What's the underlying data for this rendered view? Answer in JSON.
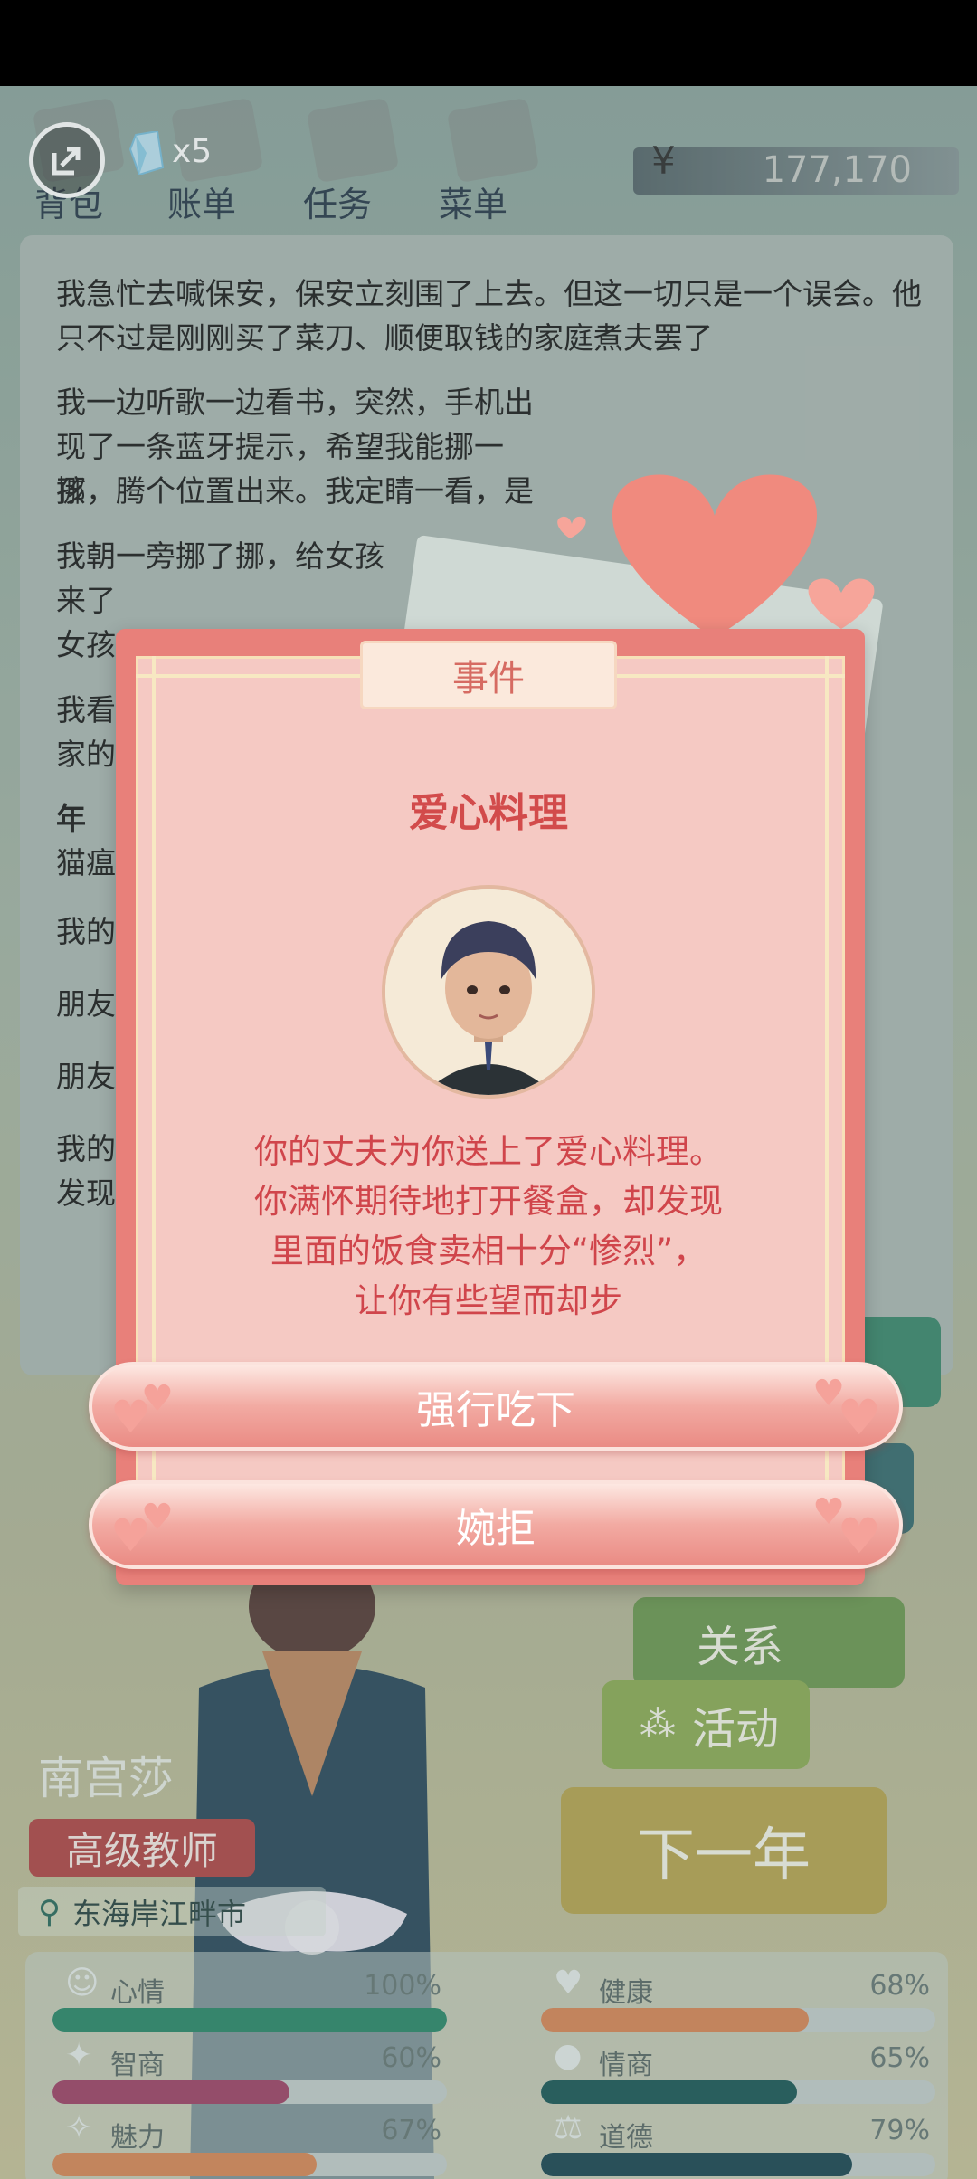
{
  "top_nav": {
    "items": [
      {
        "label": "背包"
      },
      {
        "label": "账单"
      },
      {
        "label": "任务"
      },
      {
        "label": "菜单"
      }
    ],
    "gem_count": "x5",
    "currency_symbol": "¥",
    "money": "177,170"
  },
  "story": {
    "paragraphs": [
      "我急忙去喊保安，保安立刻围了上去。但这一切只是一个误会。他只不过是刚刚买了菜刀、顺便取钱的家庭煮夫罢了",
      "我一边听歌一边看书，突然，手机出现了一条蓝牙提示，希望我能挪一挪，腾个位置出来。我定睛一看，是",
      "孩",
      "我朝一旁挪了挪，给女孩",
      "来了",
      "女孩",
      "我看",
      "家的",
      "年",
      "猫瘟",
      "我的",
      "朋友",
      "朋友",
      "我的",
      "发现"
    ]
  },
  "event_dialog": {
    "tag": "事件",
    "title": "爱心料理",
    "description_lines": [
      "你的丈夫为你送上了爱心料理。",
      "你满怀期待地打开餐盒，却发现",
      "里面的饭食卖相十分“惨烈”，",
      "让你有些望而却步"
    ],
    "buttons": [
      {
        "label": "强行吃下"
      },
      {
        "label": "婉拒"
      }
    ]
  },
  "side_menu": {
    "relation_label": "关系",
    "activity_label": "活动",
    "next_year_label": "下一年"
  },
  "character": {
    "name": "南宫莎",
    "job": "高级教师",
    "location": "东海岸江畔市"
  },
  "stats": [
    {
      "label": "心情",
      "value": "100%",
      "fraction": 1.0,
      "color": "#2f8a6c",
      "icon": "smile-icon"
    },
    {
      "label": "健康",
      "value": "68%",
      "fraction": 0.68,
      "color": "#d9895a",
      "icon": "heart-icon"
    },
    {
      "label": "智商",
      "value": "60%",
      "fraction": 0.6,
      "color": "#a2466a",
      "icon": "bulb-icon"
    },
    {
      "label": "情商",
      "value": "65%",
      "fraction": 0.65,
      "color": "#1f5b59",
      "icon": "apple-icon"
    },
    {
      "label": "魅力",
      "value": "67%",
      "fraction": 0.67,
      "color": "#d98a5a",
      "icon": "sparkle-icon"
    },
    {
      "label": "道德",
      "value": "79%",
      "fraction": 0.79,
      "color": "#1f4a55",
      "icon": "scale-icon"
    }
  ]
}
